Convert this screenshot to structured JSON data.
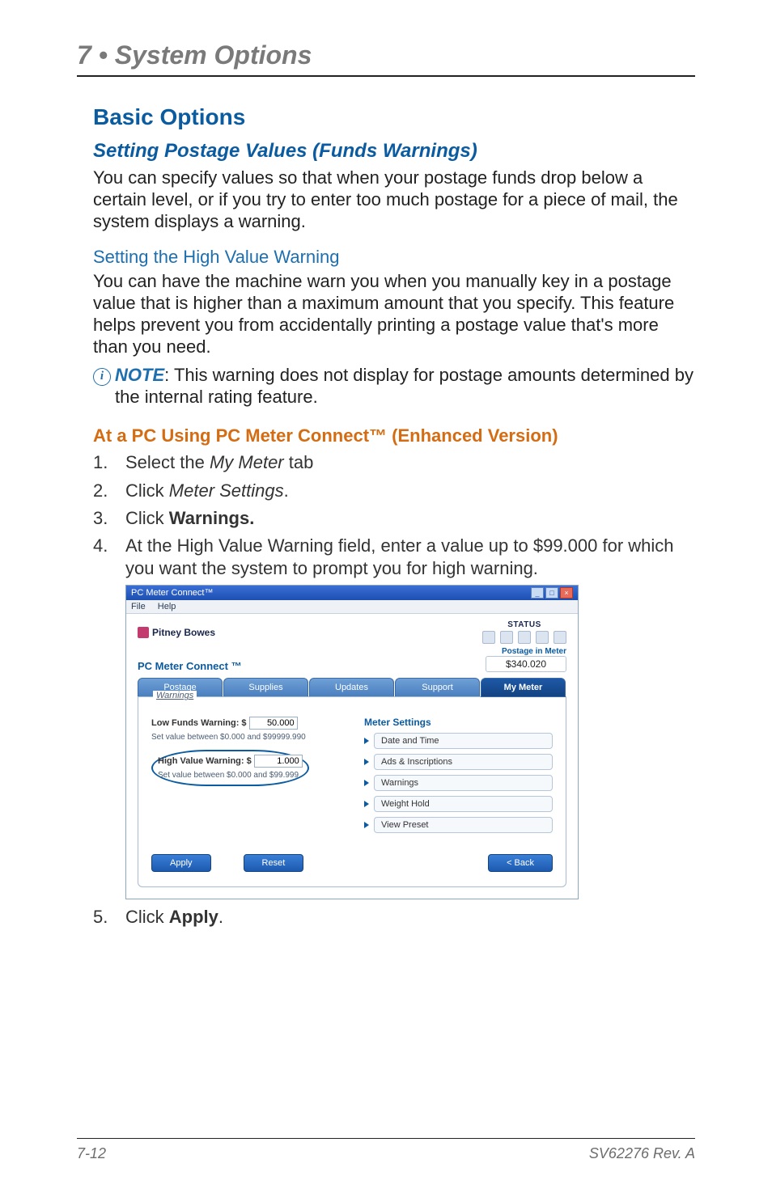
{
  "page": {
    "chapter_title": "7 • System Options",
    "footer_left": "7-12",
    "footer_right": "SV62276 Rev. A"
  },
  "headings": {
    "basic_options": "Basic Options",
    "setting_postage_values": "Setting Postage Values (Funds Warnings)",
    "setting_high_value_warning": "Setting the High Value Warning",
    "pc_connect": "At a PC Using PC Meter Connect™ (Enhanced Version)"
  },
  "paragraphs": {
    "intro": "You can specify values so that when your postage funds drop below a certain level, or if you try to enter too much postage for a piece of mail, the system displays a warning.",
    "high_value_body": "You can have the machine warn you when you manually key in a postage value that is higher than a maximum amount that you specify. This feature helps prevent you from accidentally printing a postage value that's more than you need.",
    "note_label": "NOTE",
    "note_text": ": This warning does not display for postage amounts determined by the internal rating feature."
  },
  "steps": {
    "s1_pre": "Select the ",
    "s1_em": "My Meter",
    "s1_post": " tab",
    "s2_pre": "Click ",
    "s2_em": "Meter Settings",
    "s2_post": ".",
    "s3_pre": "Click ",
    "s3_strong": "Warnings.",
    "s4": "At the High Value Warning field, enter a value up to $99.000 for which you want the system to prompt you for high warning.",
    "s5_pre": "Click ",
    "s5_strong": "Apply",
    "s5_post": "."
  },
  "app": {
    "title": "PC Meter Connect™",
    "menu_file": "File",
    "menu_help": "Help",
    "brand": "Pitney Bowes",
    "status_label": "STATUS",
    "product": "PC Meter Connect ™",
    "pim_label": "Postage in Meter",
    "pim_value": "$340.020",
    "tabs": {
      "postage": "Postage",
      "supplies": "Supplies",
      "updates": "Updates",
      "support": "Support",
      "my_meter": "My Meter"
    },
    "panel_label": "Warnings",
    "low_funds_label": "Low Funds Warning: $",
    "low_funds_value": "50.000",
    "low_funds_hint": "Set value between $0.000 and $99999.990",
    "high_value_label": "High Value Warning: $",
    "high_value_value": "1.000",
    "high_value_hint": "Set value between $0.000 and $99.999",
    "meter_settings_title": "Meter Settings",
    "ms": {
      "date_time": "Date and Time",
      "ads": "Ads & Inscriptions",
      "warnings": "Warnings",
      "weight_hold": "Weight Hold",
      "view_preset": "View Preset"
    },
    "btn_apply": "Apply",
    "btn_reset": "Reset",
    "btn_back": "< Back"
  }
}
